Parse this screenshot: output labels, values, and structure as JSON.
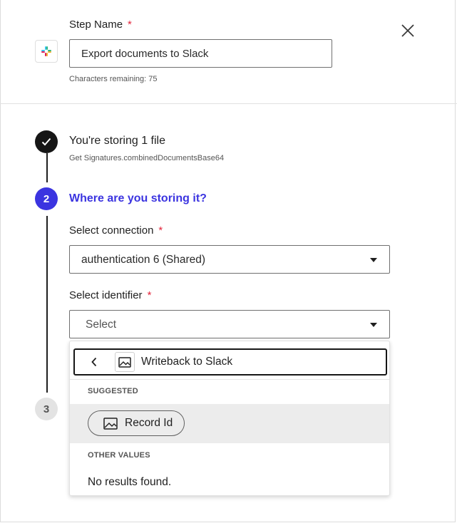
{
  "header": {
    "app_icon": "slack-logo",
    "step_name_label": "Step Name",
    "required_marker": "*",
    "step_name_value": "Export documents to Slack",
    "characters_remaining": "Characters remaining: 75",
    "close_icon": "close-icon"
  },
  "steps": [
    {
      "number": "",
      "status": "done",
      "title": "You're storing 1 file",
      "subtitle": "Get Signatures.combinedDocumentsBase64"
    },
    {
      "number": "2",
      "status": "active",
      "title": "Where are you storing it?"
    },
    {
      "number": "3",
      "status": "pending"
    }
  ],
  "form": {
    "connection_label": "Select connection",
    "connection_value": "authentication 6 (Shared)",
    "identifier_label": "Select identifier",
    "identifier_placeholder": "Select"
  },
  "dropdown": {
    "back_icon": "chevron-left-icon",
    "header_icon": "image-icon",
    "header_title": "Writeback to Slack",
    "suggested_label": "SUGGESTED",
    "suggested_items": [
      {
        "icon": "image-icon",
        "label": "Record Id"
      }
    ],
    "other_label": "OTHER VALUES",
    "no_results": "No results found."
  },
  "colors": {
    "accent": "#3b34e0",
    "required": "#e4263c",
    "done": "#161616"
  }
}
